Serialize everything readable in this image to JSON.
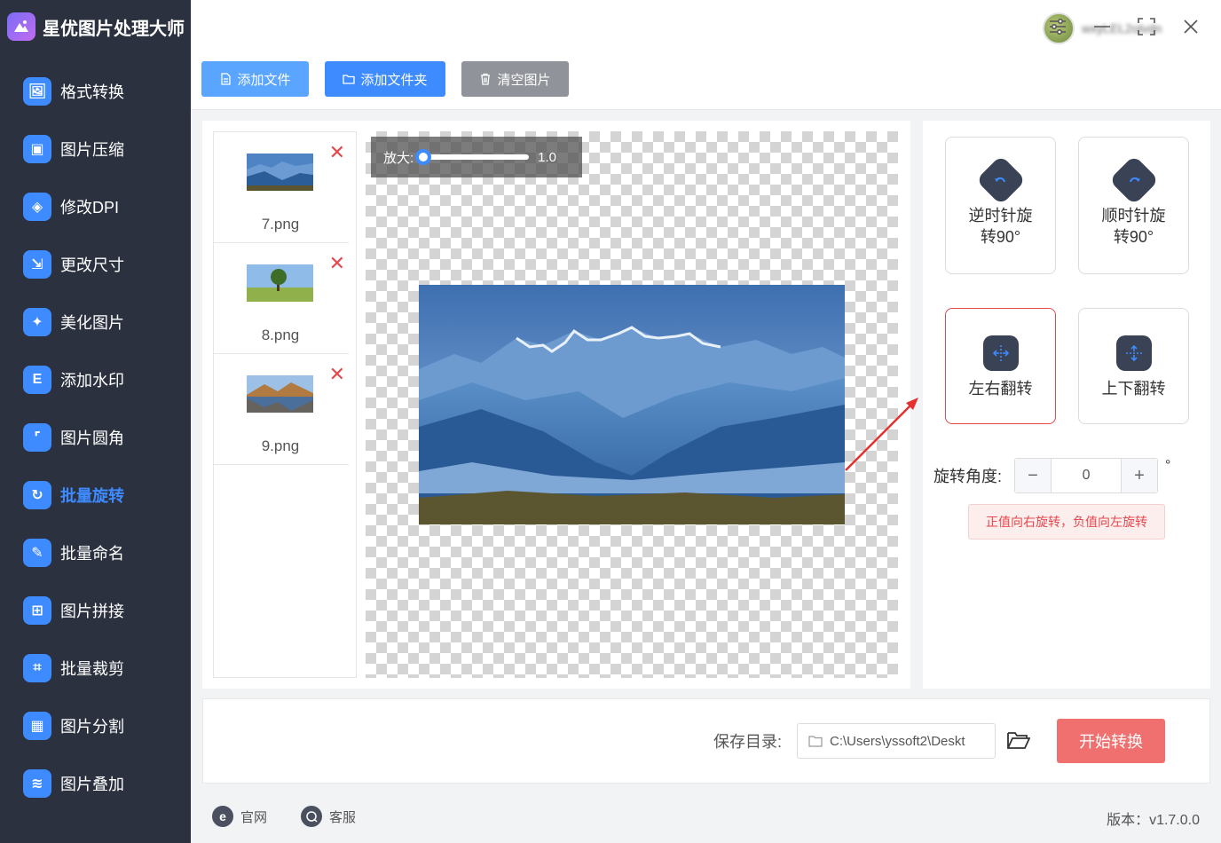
{
  "app": {
    "title": "星优图片处理大师",
    "username": "wxyLEL2olvdn"
  },
  "sidebar": {
    "items": [
      {
        "label": "格式转换",
        "icon": "format-convert-icon",
        "color": "#3d8bff"
      },
      {
        "label": "图片压缩",
        "icon": "compress-icon",
        "color": "#3d8bff"
      },
      {
        "label": "修改DPI",
        "icon": "dpi-icon",
        "color": "#3d8bff"
      },
      {
        "label": "更改尺寸",
        "icon": "resize-icon",
        "color": "#3d8bff"
      },
      {
        "label": "美化图片",
        "icon": "beautify-icon",
        "color": "#3d8bff"
      },
      {
        "label": "添加水印",
        "icon": "watermark-icon",
        "color": "#3d8bff"
      },
      {
        "label": "图片圆角",
        "icon": "round-corner-icon",
        "color": "#3d8bff"
      },
      {
        "label": "批量旋转",
        "icon": "rotate-icon",
        "color": "#3d8bff",
        "active": true
      },
      {
        "label": "批量命名",
        "icon": "rename-icon",
        "color": "#3d8bff"
      },
      {
        "label": "图片拼接",
        "icon": "stitch-icon",
        "color": "#3d8bff"
      },
      {
        "label": "批量裁剪",
        "icon": "crop-icon",
        "color": "#3d8bff"
      },
      {
        "label": "图片分割",
        "icon": "split-icon",
        "color": "#3d8bff"
      },
      {
        "label": "图片叠加",
        "icon": "overlay-icon",
        "color": "#3d8bff"
      }
    ]
  },
  "toolbar": {
    "add_file": "添加文件",
    "add_folder": "添加文件夹",
    "clear": "清空图片"
  },
  "files": [
    {
      "name": "7.png",
      "thumb": "mountains-blue"
    },
    {
      "name": "8.png",
      "thumb": "tree-meadow"
    },
    {
      "name": "9.png",
      "thumb": "lake-mountains"
    }
  ],
  "preview": {
    "zoom_label": "放大:",
    "zoom_value": "1.0",
    "zoom_fraction": 0.0
  },
  "operations": {
    "ccw": "逆时针旋转90°",
    "cw": "顺时针旋转90°",
    "flip_h": "左右翻转",
    "flip_v": "上下翻转"
  },
  "angle": {
    "label": "旋转角度:",
    "value": "0",
    "unit": "°",
    "minus": "−",
    "plus": "+",
    "hint": "正值向右旋转，负值向左旋转"
  },
  "output": {
    "label": "保存目录:",
    "path": "C:\\Users\\yssoft2\\Deskt",
    "start": "开始转换"
  },
  "footer": {
    "website": "官网",
    "support": "客服",
    "version": "版本：v1.7.0.0"
  },
  "colors": {
    "accent": "#3d8bff",
    "danger": "#e5484d",
    "start": "#f07070",
    "sidebar": "#2c3140"
  }
}
